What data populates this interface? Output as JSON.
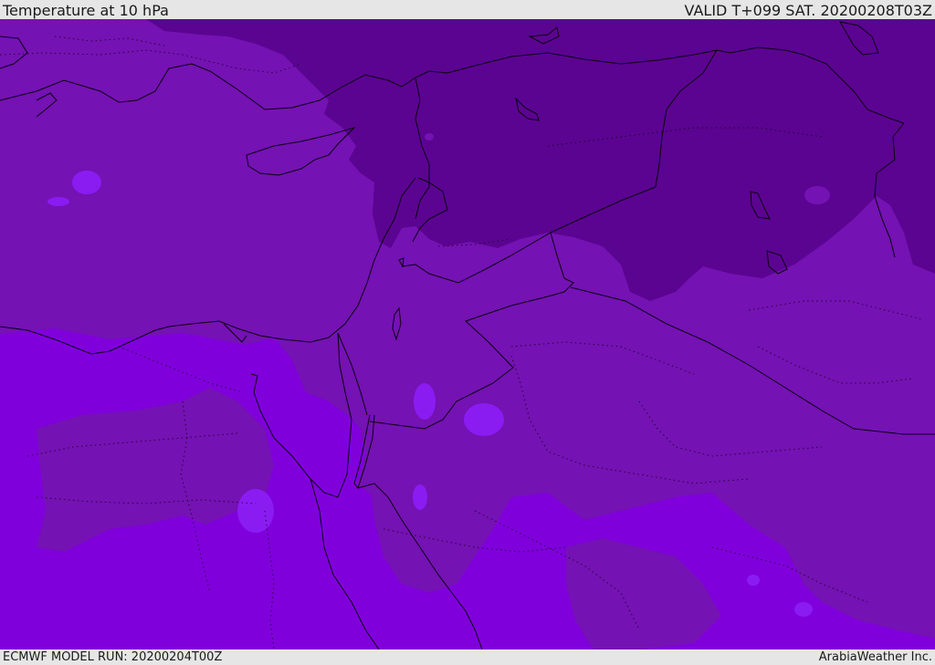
{
  "header": {
    "title": "Temperature at 10 hPa",
    "valid": "VALID T+099 SAT. 20200208T03Z"
  },
  "footer": {
    "model_run": "ECMWF MODEL RUN: 20200204T00Z",
    "credit": "ArabiaWeather Inc."
  },
  "map": {
    "field": "Temperature at 10 hPa",
    "palette": {
      "darkest": "#5b0491",
      "mid": "#7412b3",
      "light": "#8000dc",
      "lightest": "#8a1cf2",
      "borders": "#0a0010"
    }
  }
}
